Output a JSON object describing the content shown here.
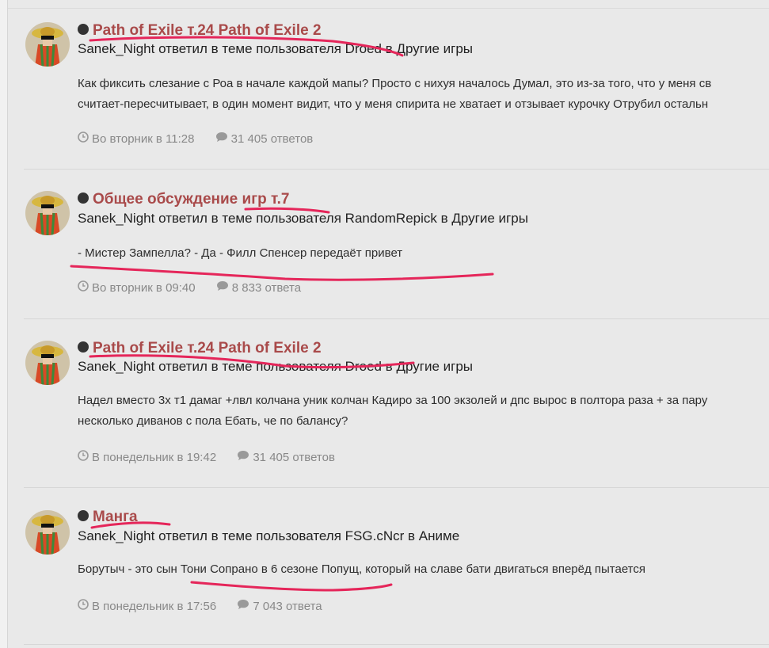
{
  "accent_color": "#a94a4a",
  "annotation_color": "#e5265a",
  "items": [
    {
      "title": "Path of Exile т.24 Path of Exile 2",
      "user": "Sanek_Night",
      "action": "ответил в теме пользователя",
      "topic_author": "Droed",
      "in_word": "в",
      "forum": "Другие игры",
      "snippet_lines": [
        "Как фиксить слезание с Роа в начале каждой мапы? Просто с нихуя началось Думал, это из-за того, что у меня св",
        "считает-пересчитывает, в один момент видит, что у меня спирита не хватает и отзывает курочку Отрубил остальн"
      ],
      "time": "Во вторник в 11:28",
      "replies": "31 405 ответов"
    },
    {
      "title": "Общее обсуждение игр т.7",
      "user": "Sanek_Night",
      "action": "ответил в теме пользователя",
      "topic_author": "RandomRepick",
      "in_word": "в",
      "forum": "Другие игры",
      "snippet_lines": [
        "- Мистер Зампелла? - Да - Филл Спенсер передаёт привет"
      ],
      "time": "Во вторник в 09:40",
      "replies": "8 833 ответа"
    },
    {
      "title": "Path of Exile т.24 Path of Exile 2",
      "user": "Sanek_Night",
      "action": "ответил в теме пользователя",
      "topic_author": "Droed",
      "in_word": "в",
      "forum": "Другие игры",
      "snippet_lines": [
        "Надел вместо 3х т1 дамаг +лвл колчана уник колчан Кадиро за 100 экзолей и дпс вырос в полтора раза + за пару",
        "несколько диванов с пола Ебать, че по балансу?"
      ],
      "time": "В понедельник в 19:42",
      "replies": "31 405 ответов"
    },
    {
      "title": "Манга",
      "user": "Sanek_Night",
      "action": "ответил в теме пользователя",
      "topic_author": "FSG.cNcr",
      "in_word": "в",
      "forum": "Аниме",
      "snippet_lines": [
        "Борутыч - это сын Тони Сопрано в 6 сезоне Попущ, который на славе бати двигаться вперёд пытается"
      ],
      "time": "В понедельник в 17:56",
      "replies": "7 043 ответа"
    }
  ]
}
